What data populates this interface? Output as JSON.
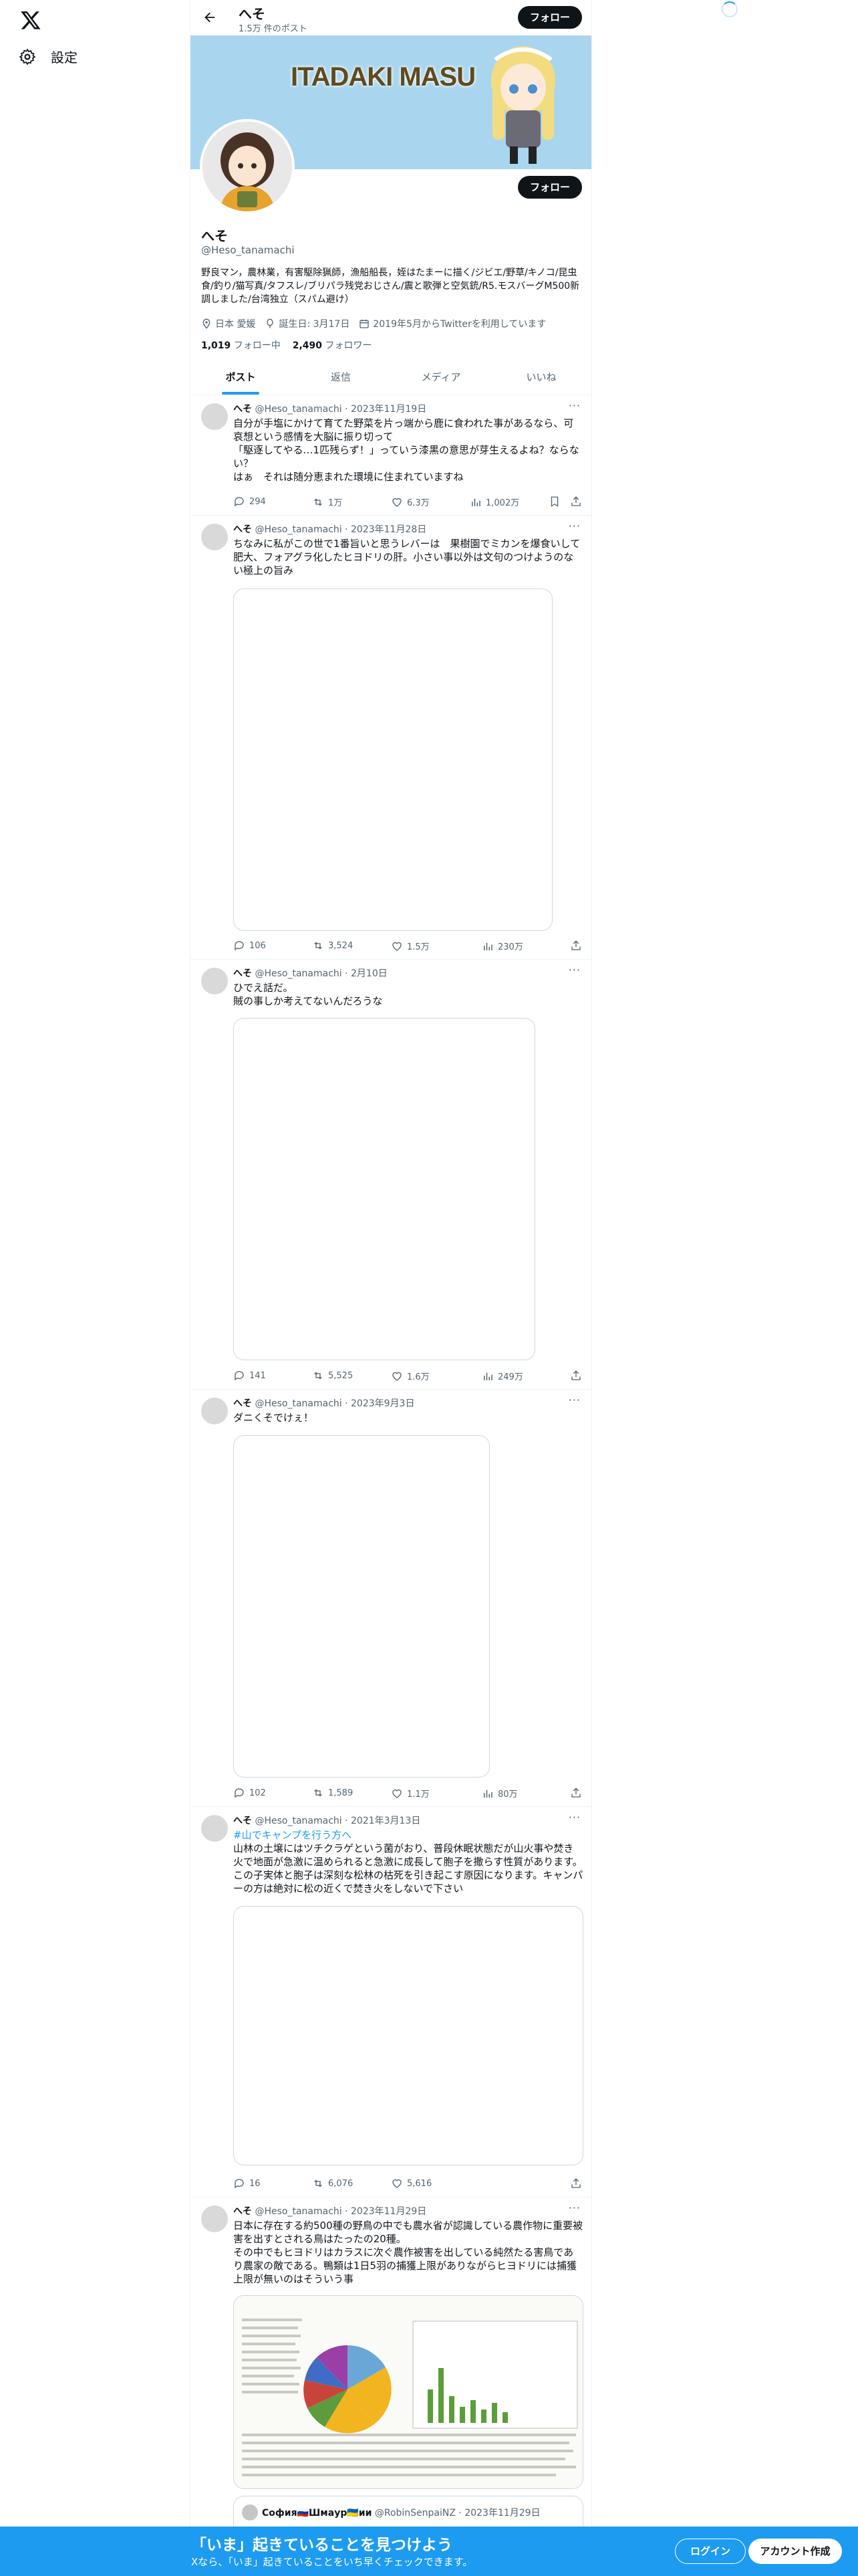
{
  "nav": {
    "settings_label": "設定"
  },
  "header": {
    "name": "へそ",
    "post_count": "1.5万 件のポスト",
    "follow_label": "フォロー"
  },
  "banner": {
    "text": "ITADAKI MASU"
  },
  "profile": {
    "name": "へそ",
    "handle": "@Heso_tanamachi",
    "follow_label": "フォロー",
    "bio": "野良マン，農林業，有害駆除猟師，漁船船長，姪はたまーに描く/ジビエ/野草/キノコ/昆虫食/釣り/猫写真/タフスレ/ブリパラ残党おじさん/震と歌弾と空気銃/R5.モスバーグM500新調しました/台湾独立（スパム避け）",
    "location": "日本 愛媛",
    "birthday": "誕生日: 3月17日",
    "joined": "2019年5月からTwitterを利用しています",
    "following_count": "1,019",
    "following_label": "フォロー中",
    "followers_count": "2,490",
    "followers_label": "フォロワー"
  },
  "tabs": [
    {
      "label": "ポスト",
      "active": true
    },
    {
      "label": "返信",
      "active": false
    },
    {
      "label": "メディア",
      "active": false
    },
    {
      "label": "いいね",
      "active": false
    }
  ],
  "tweets": [
    {
      "name": "へそ",
      "handle": "@Heso_tanamachi",
      "date": "2023年11月19日",
      "text": "自分が手塩にかけて育てた野菜を片っ端から鹿に食われた事があるなら、可哀想という感情を大脳に振り切って\n「駆逐してやる…1匹残らず！」っていう漆黒の意思が芽生えるよね？ならない？\nはぁ　それは随分恵まれた環境に住まれていますね",
      "replies": "294",
      "reposts": "1万",
      "likes": "6.3万",
      "views": "1,002万"
    },
    {
      "name": "へそ",
      "handle": "@Heso_tanamachi",
      "date": "2023年11月28日",
      "text": "ちなみに私がこの世で1番旨いと思うレバーは　果樹園でミカンを爆食いして肥大、フォアグラ化したヒヨドリの肝。小さい事以外は文句のつけようのない極上の旨み",
      "replies": "106",
      "reposts": "3,524",
      "likes": "1.5万",
      "views": "230万"
    },
    {
      "name": "へそ",
      "handle": "@Heso_tanamachi",
      "date": "2月10日",
      "text": "ひでえ話だ。\n賊の事しか考えてないんだろうな",
      "replies": "141",
      "reposts": "5,525",
      "likes": "1.6万",
      "views": "249万"
    },
    {
      "name": "へそ",
      "handle": "@Heso_tanamachi",
      "date": "2023年9月3日",
      "text": "ダニくそでけぇ！",
      "replies": "102",
      "reposts": "1,589",
      "likes": "1.1万",
      "views": "80万"
    },
    {
      "name": "へそ",
      "handle": "@Heso_tanamachi",
      "date": "2021年3月13日",
      "link": "#山でキャンプを行う方へ",
      "text": "山林の土壌にはツチクラゲという菌がおり、普段休眠状態だが山火事や焚き火で地面が急激に温められると急激に成長して胞子を撒らす性質があります。この子実体と胞子は深刻な松林の枯死を引き起こす原因になります。キャンパーの方は絶対に松の近くで焚き火をしないで下さい",
      "replies": "16",
      "reposts": "6,076",
      "likes": "5,616"
    },
    {
      "name": "へそ",
      "handle": "@Heso_tanamachi",
      "date": "2023年11月29日",
      "text": "日本に存在する約500種の野鳥の中でも農水省が認識している農作物に重要被害を出すとされる鳥はたったの20種。\nその中でもヒヨドリはカラスに次ぐ農作被害を出している純然たる害鳥であり農家の敵である。鴨類は1日5羽の捕獲上限がありながらヒヨドリには捕獲上限が無いのはそういう事",
      "quote_name": "София🇷🇺Шмаур🇺🇦ии",
      "quote_handle": "@RobinSenpaiNZ",
      "quote_date": "2023年11月29日"
    }
  ],
  "bottom_bar": {
    "title": "「いま」起きていることを見つけよう",
    "subtitle": "Xなら、「いま」起きていることをいち早くチェックできます。",
    "login": "ログイン",
    "signup": "アカウント作成"
  }
}
